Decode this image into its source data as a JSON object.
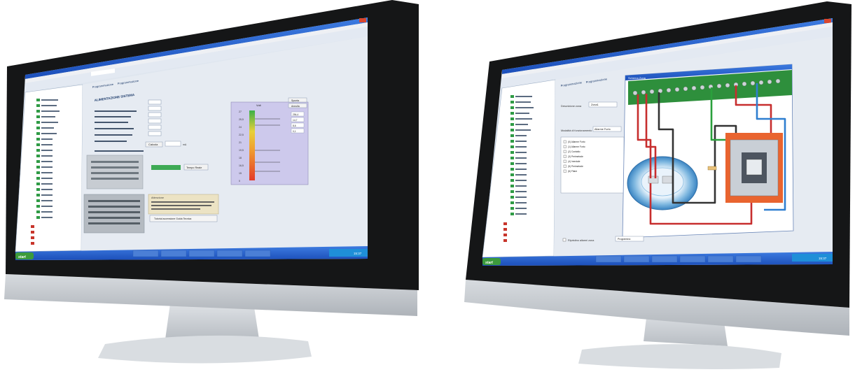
{
  "left": {
    "menu": [
      "File",
      "Programmazione",
      "Strumenti",
      "Finestra"
    ],
    "tab_a": "Programmazione",
    "tab_b": "Programmazione",
    "panel_title": "ALIMENTAZIONE SISTEMA",
    "field_units": [
      "mA",
      "mA",
      "mA",
      "mA",
      "mA"
    ],
    "calc_button": "Calcola",
    "calc_unit": "mA",
    "realtime_button": "Tempo Reale",
    "tutorial_button": "Tutorial accensione Guida Tecnica",
    "note_title": "Attenzione",
    "gauge_title": "Volt",
    "gauge_ticks": [
      "27",
      "25,5",
      "24",
      "22,5",
      "21",
      "19,5",
      "18",
      "16,5",
      "15",
      "0"
    ],
    "side_buttons": [
      "Spunta",
      "Annulla"
    ],
    "side_values": [
      "254,4",
      "14,7",
      "8,6",
      "0,1"
    ],
    "start_label": "start",
    "clock": "15:37"
  },
  "right": {
    "menu": [
      "File",
      "Programmazione",
      "Strumenti",
      "Finestra"
    ],
    "tab_a": "Programmazione",
    "tab_b": "Programmazione",
    "dialog_title": "Schema Zona",
    "field_label_1": "Descrizione zona",
    "field_value_1": "Zona1",
    "field_label_2": "Modalità di funzionamento",
    "field_value_2": "Allarme Furto",
    "list_items": [
      "(0) Allarme Furto",
      "(1) Allarme Furto",
      "(2) Contatto",
      "(3) Perimetrale",
      "(4) Inerziale",
      "(5) Perimetrale",
      "(6) Filare"
    ],
    "checkbox_label": "Ripristino allarmi zona",
    "programming_label": "Programma",
    "start_label": "start",
    "clock": "15:37"
  }
}
